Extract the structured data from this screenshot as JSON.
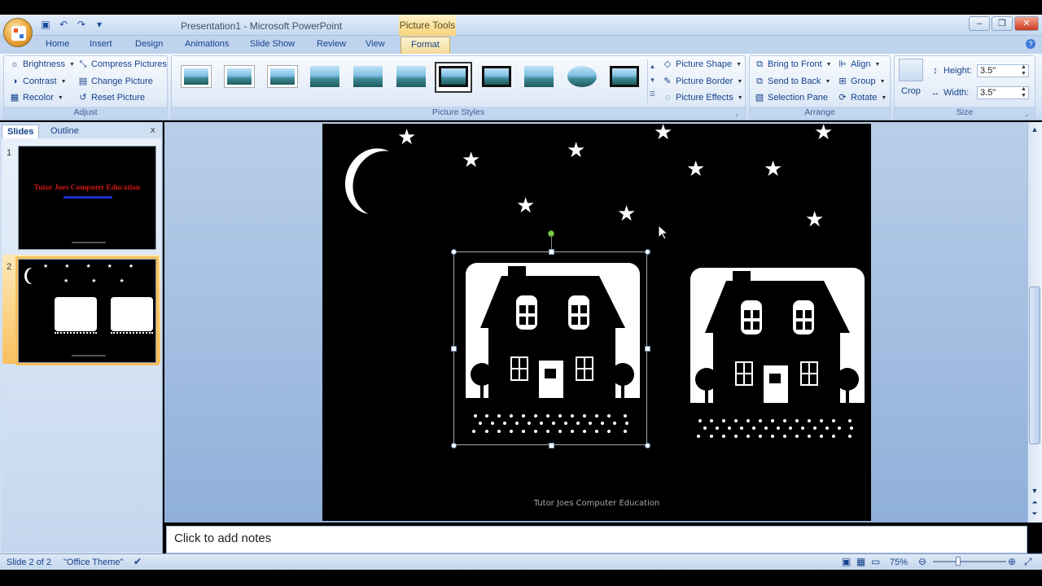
{
  "window": {
    "title": "Presentation1 - Microsoft PowerPoint",
    "contextual_tab": "Picture Tools"
  },
  "tabs": [
    "Home",
    "Insert",
    "Design",
    "Animations",
    "Slide Show",
    "Review",
    "View",
    "Format"
  ],
  "active_tab": "Format",
  "ribbon": {
    "adjust": {
      "label": "Adjust",
      "brightness": "Brightness",
      "contrast": "Contrast",
      "recolor": "Recolor",
      "compress": "Compress Pictures",
      "change": "Change Picture",
      "reset": "Reset Picture"
    },
    "picture_styles": {
      "label": "Picture Styles",
      "shape": "Picture Shape",
      "border": "Picture Border",
      "effects": "Picture Effects"
    },
    "arrange": {
      "label": "Arrange",
      "bring_front": "Bring to Front",
      "send_back": "Send to Back",
      "selection_pane": "Selection Pane",
      "align": "Align",
      "group": "Group",
      "rotate": "Rotate"
    },
    "size": {
      "label": "Size",
      "crop": "Crop",
      "height_label": "Height:",
      "height_value": "3.5\"",
      "width_label": "Width:",
      "width_value": "3.5\""
    }
  },
  "left_pane": {
    "tab_slides": "Slides",
    "tab_outline": "Outline",
    "close": "x",
    "slides": [
      {
        "number": "1",
        "title": "Tutor Joes Computer Education"
      },
      {
        "number": "2"
      }
    ]
  },
  "slide": {
    "footer": "Tutor Joes Computer Education"
  },
  "notes": {
    "placeholder": "Click to add notes"
  },
  "status": {
    "slide_info": "Slide 2 of 2",
    "theme": "\"Office Theme\"",
    "zoom": "75%"
  },
  "colors": {
    "ribbon_bg": "#dbe7f5",
    "accent_tab": "#f5dc9b",
    "slide_bg": "#000000"
  }
}
